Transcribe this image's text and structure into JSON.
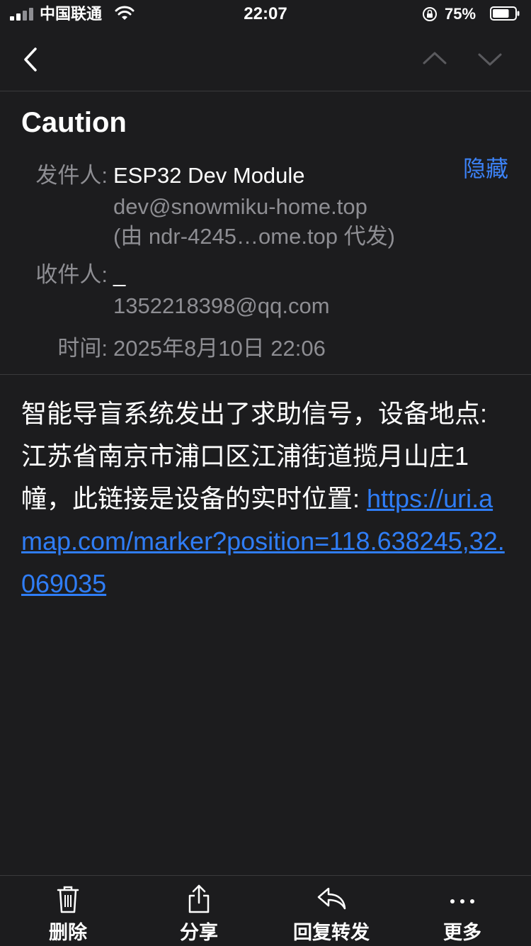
{
  "status_bar": {
    "carrier": "中国联通",
    "time": "22:07",
    "battery_percent": "75%",
    "battery_level": 0.75
  },
  "nav": {
    "back_icon": "chevron-left-icon",
    "prev_icon": "chevron-up-icon",
    "next_icon": "chevron-down-icon"
  },
  "message": {
    "subject": "Caution",
    "hide_label": "隐藏",
    "from_label": "发件人:",
    "from_name": "ESP32 Dev Module",
    "from_email": "dev@snowmiku-home.top",
    "from_via": "(由 ndr-4245…ome.top 代发)",
    "to_label": "收件人:",
    "to_name": "_",
    "to_email": "1352218398@qq.com",
    "time_label": "时间:",
    "time_value": "2025年8月10日 22:06",
    "body_text": "智能导盲系统发出了求助信号，设备地点: 江苏省南京市浦口区江浦街道揽月山庄1幢，此链接是设备的实时位置: ",
    "body_link": "https://uri.amap.com/marker?position=118.638245,32.069035"
  },
  "toolbar": {
    "delete_label": "删除",
    "share_label": "分享",
    "reply_label": "回复转发",
    "more_label": "更多"
  },
  "colors": {
    "background": "#1c1c1e",
    "accent": "#3c82f6",
    "link": "#2f7df6",
    "secondary_text": "#8e8e93"
  }
}
